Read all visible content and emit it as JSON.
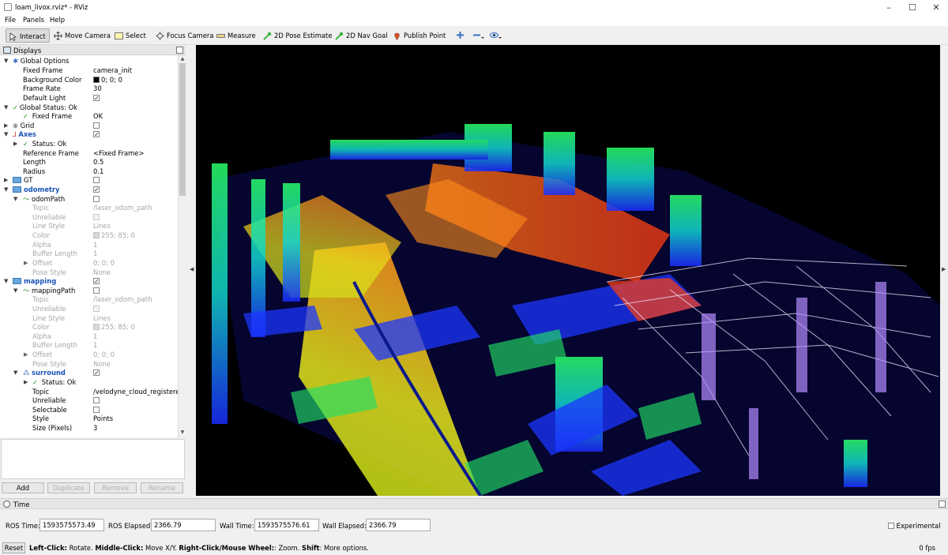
{
  "window": {
    "title": "loam_livox.rviz* - RViz",
    "controls": [
      "–",
      "☐",
      "✕"
    ]
  },
  "menu": [
    "File",
    "Panels",
    "Help"
  ],
  "toolbar": {
    "tools": [
      {
        "label": "Interact",
        "icon": "interact-icon"
      },
      {
        "label": "Move Camera",
        "icon": "move-camera-icon"
      },
      {
        "label": "Select",
        "icon": "select-icon"
      },
      {
        "label": "Focus Camera",
        "icon": "focus-camera-icon"
      },
      {
        "label": "Measure",
        "icon": "measure-icon"
      },
      {
        "label": "2D Pose Estimate",
        "icon": "pose-estimate-icon"
      },
      {
        "label": "2D Nav Goal",
        "icon": "nav-goal-icon"
      },
      {
        "label": "Publish Point",
        "icon": "publish-point-icon"
      }
    ]
  },
  "displays": {
    "title": "Displays",
    "rows": [
      {
        "label": "Global Options",
        "value": ""
      },
      {
        "label": "Fixed Frame",
        "value": "camera_init"
      },
      {
        "label": "Background Color",
        "value": "0; 0; 0"
      },
      {
        "label": "Frame Rate",
        "value": "30"
      },
      {
        "label": "Default Light",
        "value": ""
      },
      {
        "label": "Global Status: Ok",
        "value": ""
      },
      {
        "label": "Fixed Frame",
        "value": "OK"
      },
      {
        "label": "Grid",
        "value": ""
      },
      {
        "label": "Axes",
        "value": ""
      },
      {
        "label": "Status: Ok",
        "value": ""
      },
      {
        "label": "Reference Frame",
        "value": "<Fixed Frame>"
      },
      {
        "label": "Length",
        "value": "0.5"
      },
      {
        "label": "Radius",
        "value": "0.1"
      },
      {
        "label": "GT",
        "value": ""
      },
      {
        "label": "odometry",
        "value": ""
      },
      {
        "label": "odomPath",
        "value": ""
      },
      {
        "label": "Topic",
        "value": "/laser_odom_path"
      },
      {
        "label": "Unreliable",
        "value": ""
      },
      {
        "label": "Line Style",
        "value": "Lines"
      },
      {
        "label": "Color",
        "value": "255; 85; 0"
      },
      {
        "label": "Alpha",
        "value": "1"
      },
      {
        "label": "Buffer Length",
        "value": "1"
      },
      {
        "label": "Offset",
        "value": "0; 0; 0"
      },
      {
        "label": "Pose Style",
        "value": "None"
      },
      {
        "label": "mapping",
        "value": ""
      },
      {
        "label": "mappingPath",
        "value": ""
      },
      {
        "label": "Topic",
        "value": "/laser_odom_path"
      },
      {
        "label": "Unreliable",
        "value": ""
      },
      {
        "label": "Line Style",
        "value": "Lines"
      },
      {
        "label": "Color",
        "value": "255; 85; 0"
      },
      {
        "label": "Alpha",
        "value": "1"
      },
      {
        "label": "Buffer Length",
        "value": "1"
      },
      {
        "label": "Offset",
        "value": "0; 0; 0"
      },
      {
        "label": "Pose Style",
        "value": "None"
      },
      {
        "label": "surround",
        "value": ""
      },
      {
        "label": "Status: Ok",
        "value": ""
      },
      {
        "label": "Topic",
        "value": "/velodyne_cloud_registered"
      },
      {
        "label": "Unreliable",
        "value": ""
      },
      {
        "label": "Selectable",
        "value": ""
      },
      {
        "label": "Style",
        "value": "Points"
      },
      {
        "label": "Size (Pixels)",
        "value": "3"
      }
    ],
    "colors": {
      "background_color": "#000000",
      "path_color": "#ff5500",
      "group_label": "#1a54b5",
      "ok": "#1f8f1f"
    }
  },
  "panel_buttons": [
    "Add",
    "Duplicate",
    "Remove",
    "Rename"
  ],
  "time": {
    "title": "Time",
    "ros_time_label": "ROS Time:",
    "ros_time": "1593575573.49",
    "ros_elapsed_label": "ROS Elapsed:",
    "ros_elapsed": "2366.79",
    "wall_time_label": "Wall Time:",
    "wall_time": "1593575576.61",
    "wall_elapsed_label": "Wall Elapsed:",
    "wall_elapsed": "2366.79",
    "experimental": "Experimental"
  },
  "status": {
    "reset": "Reset",
    "hint_1_bold": "Left-Click:",
    "hint_1": " Rotate. ",
    "hint_2_bold": "Middle-Click:",
    "hint_2": " Move X/Y. ",
    "hint_3_bold": "Right-Click/Mouse Wheel:",
    "hint_3": ": Zoom. ",
    "hint_4_bold": "Shift",
    "hint_4": ": More options.",
    "fps": "0 fps"
  }
}
